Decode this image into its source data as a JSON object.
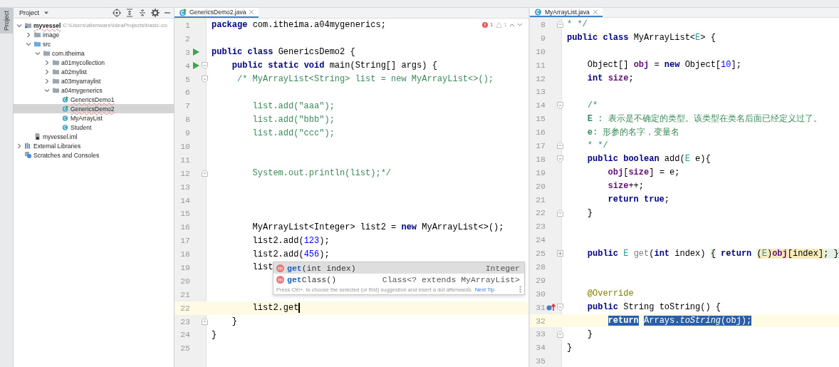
{
  "side_tab": {
    "label": "Project",
    "selected": true
  },
  "project": {
    "title": "Project",
    "tree": [
      {
        "name": "myvessel",
        "path": "C:\\Users\\alienware\\IdeaProjects\\basic-co",
        "kind": "module",
        "expanded": true,
        "selected": false,
        "children": [
          {
            "name": "image",
            "kind": "folder",
            "expanded": false,
            "selected": false
          },
          {
            "name": "src",
            "kind": "source",
            "expanded": true,
            "selected": false,
            "children": [
              {
                "name": "com.itheima",
                "kind": "folder",
                "expanded": true,
                "selected": false,
                "children": [
                  {
                    "name": "a01mycollection",
                    "kind": "folder",
                    "expanded": false,
                    "selected": false
                  },
                  {
                    "name": "a02mylist",
                    "kind": "folder",
                    "expanded": false,
                    "selected": false
                  },
                  {
                    "name": "a03myarraylist",
                    "kind": "folder",
                    "expanded": false,
                    "selected": false
                  },
                  {
                    "name": "a04mygenerics",
                    "kind": "folder",
                    "expanded": true,
                    "selected": false,
                    "children": [
                      {
                        "name": "GenericsDemo1",
                        "kind": "main-class",
                        "selected": false
                      },
                      {
                        "name": "GenericsDemo2",
                        "kind": "main-class",
                        "selected": true
                      },
                      {
                        "name": "MyArrayList",
                        "kind": "class",
                        "selected": false
                      },
                      {
                        "name": "Student",
                        "kind": "class",
                        "selected": false
                      }
                    ]
                  }
                ]
              }
            ]
          },
          {
            "name": "myvessel.iml",
            "kind": "file",
            "selected": false
          }
        ]
      },
      {
        "name": "External Libraries",
        "kind": "library",
        "expanded": false,
        "selected": false
      },
      {
        "name": "Scratches and Consoles",
        "kind": "scratches",
        "selected": false
      }
    ]
  },
  "editors": [
    {
      "tab": {
        "label": "GenericsDemo2.java",
        "kind": "main-class",
        "selected": true
      },
      "inspections": {
        "errors": "1",
        "warnings": "1"
      },
      "lines": [
        {
          "n": "1",
          "segs": [
            {
              "t": "package",
              "kind": "kw"
            },
            {
              "t": " com.itheima.a04mygenerics;"
            }
          ]
        },
        {
          "n": "2"
        },
        {
          "n": "3",
          "marker": {
            "kind": "run"
          },
          "segs": [
            {
              "t": "public class",
              "kind": "kw"
            },
            {
              "t": " GenericsDemo2 {"
            }
          ]
        },
        {
          "n": "4",
          "marker": {
            "kind": "run"
          },
          "fold": {
            "kind": "open"
          },
          "segs": [
            {
              "t": "    public static void",
              "kind": "kw"
            },
            {
              "t": " main(String[] args) {"
            }
          ]
        },
        {
          "n": "5",
          "fold": {
            "kind": "open"
          },
          "segs": [
            {
              "t": "     /* MyArrayList<String> list = new MyArrayList<>();",
              "kind": "cm"
            }
          ]
        },
        {
          "n": "6"
        },
        {
          "n": "7",
          "segs": [
            {
              "t": "        list.add(\"aaa\");",
              "kind": "cm"
            }
          ]
        },
        {
          "n": "8",
          "segs": [
            {
              "t": "        list.add(\"bbb\");",
              "kind": "cm"
            }
          ]
        },
        {
          "n": "9",
          "segs": [
            {
              "t": "        list.add(\"ccc\");",
              "kind": "cm"
            }
          ]
        },
        {
          "n": "10"
        },
        {
          "n": "11"
        },
        {
          "n": "12",
          "fold": {
            "kind": "close"
          },
          "segs": [
            {
              "t": "        System.out.println(list);*/",
              "kind": "cm"
            }
          ]
        },
        {
          "n": "13"
        },
        {
          "n": "14"
        },
        {
          "n": "15"
        },
        {
          "n": "16",
          "segs": [
            {
              "t": "        MyArrayList<Integer> list2 = "
            },
            {
              "t": "new",
              "kind": "kw"
            },
            {
              "t": " MyArrayList<>();"
            }
          ]
        },
        {
          "n": "17",
          "segs": [
            {
              "t": "        list2.add("
            },
            {
              "t": "123",
              "kind": "num"
            },
            {
              "t": ");"
            }
          ]
        },
        {
          "n": "18",
          "segs": [
            {
              "t": "        list2.add("
            },
            {
              "t": "456",
              "kind": "num"
            },
            {
              "t": ");"
            }
          ]
        },
        {
          "n": "19",
          "segs": [
            {
              "t": "        list"
            }
          ],
          "completion": {
            "items": [
              {
                "icon": "m",
                "match": "get",
                "rest": "(int index)",
                "type": "Integer",
                "selected": true
              },
              {
                "icon": "m",
                "match": "get",
                "rest": "Class()",
                "type": "Class<? extends MyArrayList>",
                "selected": false
              }
            ],
            "hint": "Press Ctrl+. to choose the selected (or first) suggestion and insert a dot afterwards",
            "link": "Next Tip"
          }
        },
        {
          "n": "20"
        },
        {
          "n": "21"
        },
        {
          "n": "22",
          "current": true,
          "caret": true,
          "segs": [
            {
              "t": "        list2.get"
            }
          ]
        },
        {
          "n": "23",
          "fold": {
            "kind": "close"
          },
          "segs": [
            {
              "t": "    }"
            }
          ]
        },
        {
          "n": "24",
          "segs": [
            {
              "t": "}"
            }
          ]
        },
        {
          "n": "25"
        }
      ]
    },
    {
      "tab": {
        "label": "MyArrayList.java",
        "kind": "class",
        "selected": true
      },
      "lines": [
        {
          "n": "8",
          "fold": {
            "kind": "close"
          },
          "segs": [
            {
              "t": "* */",
              "kind": "cm"
            }
          ]
        },
        {
          "n": "9",
          "segs": [
            {
              "t": "public class",
              "kind": "kw"
            },
            {
              "t": " MyArrayList<"
            },
            {
              "t": "E",
              "kind": "tp"
            },
            {
              "t": "> {"
            }
          ]
        },
        {
          "n": "10"
        },
        {
          "n": "11",
          "segs": [
            {
              "t": "    Object[] "
            },
            {
              "t": "obj",
              "kind": "fld"
            },
            {
              "t": " = "
            },
            {
              "t": "new",
              "kind": "kw"
            },
            {
              "t": " Object["
            },
            {
              "t": "10",
              "kind": "num"
            },
            {
              "t": "];"
            }
          ]
        },
        {
          "n": "12",
          "segs": [
            {
              "t": "    int",
              "kind": "kw"
            },
            {
              "t": " size",
              "kind": "fld"
            },
            {
              "t": ";"
            }
          ]
        },
        {
          "n": "13"
        },
        {
          "n": "14",
          "fold": {
            "kind": "open"
          },
          "segs": [
            {
              "t": "    /*",
              "kind": "cm"
            }
          ]
        },
        {
          "n": "15",
          "segs": [
            {
              "t": "    E",
              "kind": "cmb"
            },
            {
              "t": " : 表示是不确定的类型。该类型在类名后面已经定义过了。",
              "kind": "cm"
            }
          ]
        },
        {
          "n": "16",
          "segs": [
            {
              "t": "    e",
              "kind": "cmb"
            },
            {
              "t": ": 形参的名字，变量名",
              "kind": "cm"
            }
          ]
        },
        {
          "n": "17",
          "fold": {
            "kind": "close"
          },
          "segs": [
            {
              "t": "    * */",
              "kind": "cm"
            }
          ]
        },
        {
          "n": "18",
          "fold": {
            "kind": "open"
          },
          "segs": [
            {
              "t": "    public boolean",
              "kind": "kw"
            },
            {
              "t": " add("
            },
            {
              "t": "E",
              "kind": "tp"
            },
            {
              "t": " e){"
            }
          ]
        },
        {
          "n": "19",
          "segs": [
            {
              "t": "        obj",
              "kind": "fld"
            },
            {
              "t": "["
            },
            {
              "t": "size",
              "kind": "fld"
            },
            {
              "t": "] = e;"
            }
          ]
        },
        {
          "n": "20",
          "segs": [
            {
              "t": "        size",
              "kind": "fld"
            },
            {
              "t": "++;"
            }
          ]
        },
        {
          "n": "21",
          "segs": [
            {
              "t": "        return true",
              "kind": "kw"
            },
            {
              "t": ";"
            }
          ]
        },
        {
          "n": "22",
          "fold": {
            "kind": "close"
          },
          "segs": [
            {
              "t": "    }"
            }
          ]
        },
        {
          "n": "23"
        },
        {
          "n": "24"
        },
        {
          "n": "25",
          "fold": {
            "kind": "collapsed"
          },
          "segs": [
            {
              "t": "    public",
              "kind": "kw"
            },
            {
              "t": " E",
              "kind": "tp"
            },
            {
              "t": " get",
              "kind": "unused"
            },
            {
              "t": "("
            },
            {
              "t": "int",
              "kind": "kw"
            },
            {
              "t": " index) "
            },
            {
              "t": "{",
              "brace_match": true
            },
            {
              "t": " return ",
              "kind": "kw"
            },
            {
              "t": "(",
              "folded": true
            },
            {
              "t": "E",
              "kind": "tp",
              "folded": true
            },
            {
              "t": ")",
              "folded": true
            },
            {
              "t": "obj",
              "kind": "fld",
              "folded": true
            },
            {
              "t": "[index]",
              "folded": true
            },
            {
              "t": "; }",
              "brace_match": true
            }
          ]
        },
        {
          "n": "28"
        },
        {
          "n": "29"
        },
        {
          "n": "30",
          "segs": [
            {
              "t": "    @Override",
              "kind": "ann"
            }
          ]
        },
        {
          "n": "31",
          "marker": {
            "kind": "override"
          },
          "fold": {
            "kind": "open"
          },
          "segs": [
            {
              "t": "    public",
              "kind": "kw"
            },
            {
              "t": " String toString() {"
            }
          ]
        },
        {
          "n": "32",
          "current": true,
          "segs": [
            {
              "t": "        return",
              "kind": "kw",
              "selected": true
            },
            {
              "t": " Arrays.",
              "selected": true
            },
            {
              "t": "toString",
              "kind": "static",
              "selected": true
            },
            {
              "t": "(obj);",
              "selected": true
            }
          ]
        },
        {
          "n": "33",
          "fold": {
            "kind": "close"
          },
          "segs": [
            {
              "t": "    }"
            }
          ]
        },
        {
          "n": "34",
          "segs": [
            {
              "t": "}"
            }
          ]
        },
        {
          "n": "35"
        }
      ]
    }
  ]
}
